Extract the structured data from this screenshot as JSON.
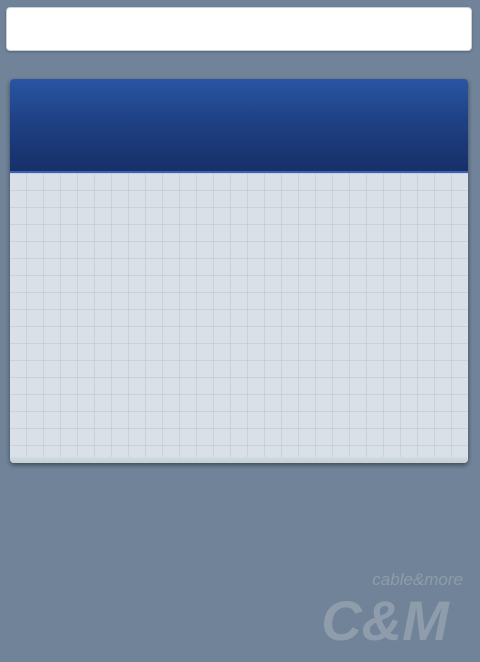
{
  "search": {
    "value": "",
    "placeholder": ""
  },
  "panel": {
    "title": ""
  },
  "brand": {
    "tagline": "cable&more",
    "monogram": "C&M"
  },
  "colors": {
    "background": "#708399",
    "panel_header": "#1f4185",
    "panel_body": "#d9e0e7",
    "logo": "#8e9cab"
  }
}
